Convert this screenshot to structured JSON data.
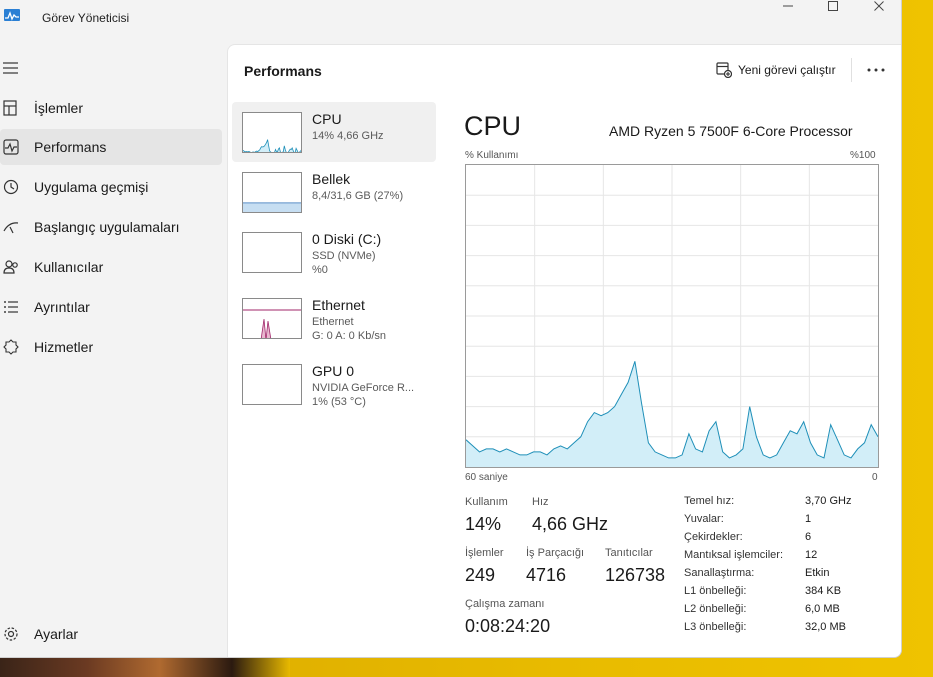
{
  "window": {
    "title": "Görev Yöneticisi"
  },
  "sidebar": {
    "items": [
      {
        "label": "İşlemler",
        "icon": "processes-icon"
      },
      {
        "label": "Performans",
        "icon": "performance-icon",
        "active": true
      },
      {
        "label": "Uygulama geçmişi",
        "icon": "history-icon"
      },
      {
        "label": "Başlangıç uygulamaları",
        "icon": "startup-icon"
      },
      {
        "label": "Kullanıcılar",
        "icon": "users-icon"
      },
      {
        "label": "Ayrıntılar",
        "icon": "details-icon"
      },
      {
        "label": "Hizmetler",
        "icon": "services-icon"
      }
    ],
    "settings_label": "Ayarlar"
  },
  "header": {
    "title": "Performans",
    "run_task_label": "Yeni görevi çalıştır",
    "more_label": "..."
  },
  "devices": [
    {
      "name": "CPU",
      "line1": "14% 4,66 GHz",
      "line2": ""
    },
    {
      "name": "Bellek",
      "line1": "8,4/31,6 GB (27%)",
      "line2": "",
      "fill_fraction": 0.27
    },
    {
      "name": "0 Diski (C:)",
      "line1": "SSD (NVMe)",
      "line2": "%0"
    },
    {
      "name": "Ethernet",
      "line1": "Ethernet",
      "line2": "G: 0 A: 0 Kb/sn"
    },
    {
      "name": "GPU 0",
      "line1": "NVIDIA GeForce R...",
      "line2": "1% (53 °C)"
    }
  ],
  "detail": {
    "title": "CPU",
    "model": "AMD Ryzen 5 7500F 6-Core Processor",
    "y_axis_label": "% Kullanımı",
    "y_max_label": "%100",
    "x_left_label": "60 saniye",
    "x_right_label": "0",
    "stats": {
      "usage_label": "Kullanım",
      "usage_value": "14%",
      "speed_label": "Hız",
      "speed_value": "4,66 GHz",
      "processes_label": "İşlemler",
      "processes_value": "249",
      "threads_label": "İş Parçacığı",
      "threads_value": "4716",
      "handles_label": "Tanıtıcılar",
      "handles_value": "126738",
      "uptime_label": "Çalışma zamanı",
      "uptime_value": "0:08:24:20"
    },
    "specs": [
      {
        "key": "Temel hız:",
        "value": "3,70 GHz"
      },
      {
        "key": "Yuvalar:",
        "value": "1"
      },
      {
        "key": "Çekirdekler:",
        "value": "6"
      },
      {
        "key": "Mantıksal işlemciler:",
        "value": "12"
      },
      {
        "key": "Sanallaştırma:",
        "value": "Etkin"
      },
      {
        "key": "L1 önbelleği:",
        "value": "384 KB"
      },
      {
        "key": "L2 önbelleği:",
        "value": "6,0 MB"
      },
      {
        "key": "L3 önbelleği:",
        "value": "32,0 MB"
      }
    ]
  },
  "cpu_history_percent": [
    9,
    7,
    5,
    6,
    6,
    5,
    6,
    5,
    4,
    4,
    5,
    5,
    4,
    6,
    7,
    6,
    8,
    10,
    15,
    18,
    17,
    18,
    20,
    24,
    28,
    35,
    21,
    8,
    5,
    4,
    3,
    3,
    4,
    11,
    6,
    5,
    12,
    15,
    5,
    3,
    4,
    6,
    20,
    10,
    4,
    3,
    4,
    8,
    12,
    11,
    15,
    8,
    4,
    3,
    14,
    9,
    4,
    3,
    6,
    8,
    14,
    10
  ],
  "colors": {
    "cpu_line": "#1e8fb8",
    "cpu_fill": "#d2eef8",
    "memory_fill": "#c6def2",
    "ethernet_line": "#a0266a"
  }
}
